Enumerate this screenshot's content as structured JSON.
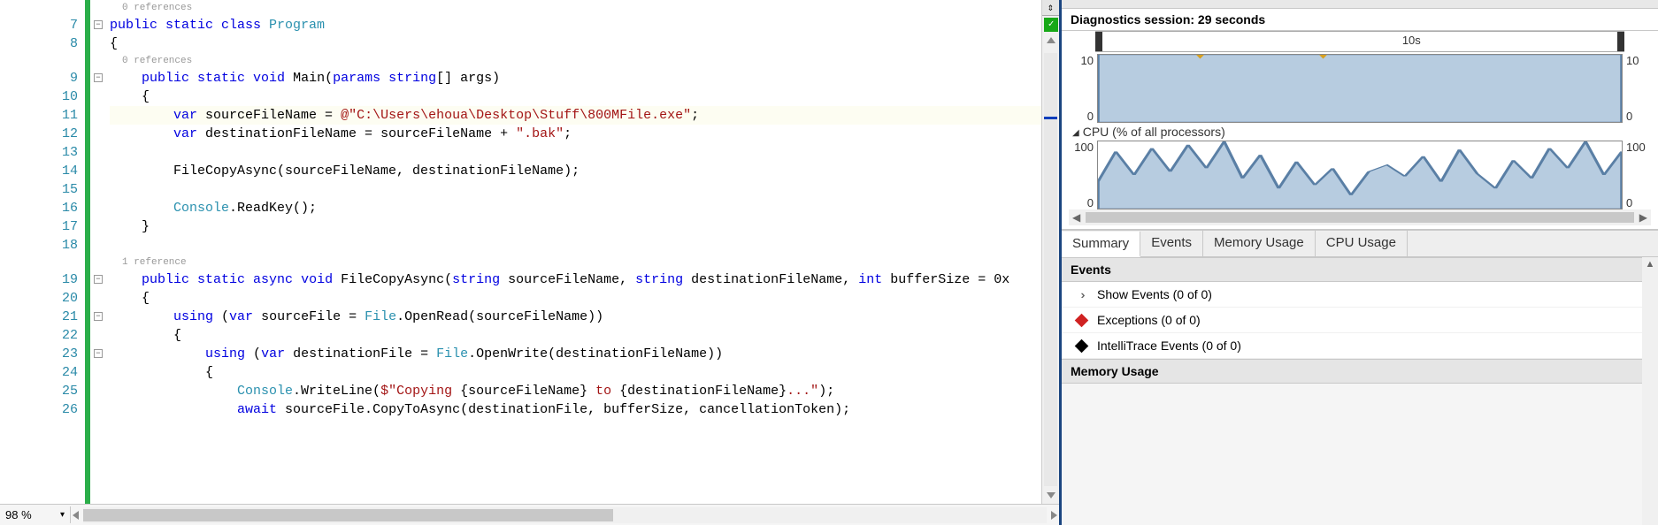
{
  "editor": {
    "zoom": "98 %",
    "refs_class": "0 references",
    "refs_main": "0 references",
    "refs_copy": "1 reference",
    "lines": {
      "7": {
        "parts": [
          {
            "t": "public ",
            "c": "kw"
          },
          {
            "t": "static ",
            "c": "kw"
          },
          {
            "t": "class ",
            "c": "kw"
          },
          {
            "t": "Program",
            "c": "type"
          }
        ]
      },
      "8": {
        "parts": [
          {
            "t": "{"
          }
        ]
      },
      "9": {
        "parts": [
          {
            "t": "    ",
            "c": ""
          },
          {
            "t": "public ",
            "c": "kw"
          },
          {
            "t": "static ",
            "c": "kw"
          },
          {
            "t": "void ",
            "c": "kw"
          },
          {
            "t": "Main(",
            "c": ""
          },
          {
            "t": "params ",
            "c": "kw"
          },
          {
            "t": "string",
            "c": "kw"
          },
          {
            "t": "[] args)",
            "c": ""
          }
        ]
      },
      "10": {
        "parts": [
          {
            "t": "    {"
          }
        ]
      },
      "11": {
        "parts": [
          {
            "t": "        ",
            "c": ""
          },
          {
            "t": "var ",
            "c": "kw"
          },
          {
            "t": "sourceFileName = ",
            "c": ""
          },
          {
            "t": "@\"C:\\Users\\ehoua\\Desktop\\Stuff\\800MFile.exe\"",
            "c": "str"
          },
          {
            "t": ";",
            "c": ""
          }
        ]
      },
      "12": {
        "parts": [
          {
            "t": "        ",
            "c": ""
          },
          {
            "t": "var ",
            "c": "kw"
          },
          {
            "t": "destinationFileName = sourceFileName + ",
            "c": ""
          },
          {
            "t": "\".bak\"",
            "c": "str"
          },
          {
            "t": ";",
            "c": ""
          }
        ]
      },
      "13": {
        "parts": [
          {
            "t": " "
          }
        ]
      },
      "14": {
        "parts": [
          {
            "t": "        FileCopyAsync(sourceFileName, destinationFileName);"
          }
        ]
      },
      "15": {
        "parts": [
          {
            "t": " "
          }
        ]
      },
      "16": {
        "parts": [
          {
            "t": "        ",
            "c": ""
          },
          {
            "t": "Console",
            "c": "type"
          },
          {
            "t": ".ReadKey();",
            "c": ""
          }
        ]
      },
      "17": {
        "parts": [
          {
            "t": "    }"
          }
        ]
      },
      "18": {
        "parts": [
          {
            "t": " "
          }
        ]
      },
      "19": {
        "parts": [
          {
            "t": "    ",
            "c": ""
          },
          {
            "t": "public ",
            "c": "kw"
          },
          {
            "t": "static ",
            "c": "kw"
          },
          {
            "t": "async ",
            "c": "kw"
          },
          {
            "t": "void ",
            "c": "kw"
          },
          {
            "t": "FileCopyAsync(",
            "c": ""
          },
          {
            "t": "string ",
            "c": "kw"
          },
          {
            "t": "sourceFileName, ",
            "c": ""
          },
          {
            "t": "string ",
            "c": "kw"
          },
          {
            "t": "destinationFileName, ",
            "c": ""
          },
          {
            "t": "int ",
            "c": "kw"
          },
          {
            "t": "bufferSize = 0x",
            "c": ""
          }
        ]
      },
      "20": {
        "parts": [
          {
            "t": "    {"
          }
        ]
      },
      "21": {
        "parts": [
          {
            "t": "        ",
            "c": ""
          },
          {
            "t": "using ",
            "c": "kw"
          },
          {
            "t": "(",
            "c": ""
          },
          {
            "t": "var ",
            "c": "kw"
          },
          {
            "t": "sourceFile = ",
            "c": ""
          },
          {
            "t": "File",
            "c": "type"
          },
          {
            "t": ".OpenRead(sourceFileName))",
            "c": ""
          }
        ]
      },
      "22": {
        "parts": [
          {
            "t": "        {"
          }
        ]
      },
      "23": {
        "parts": [
          {
            "t": "            ",
            "c": ""
          },
          {
            "t": "using ",
            "c": "kw"
          },
          {
            "t": "(",
            "c": ""
          },
          {
            "t": "var ",
            "c": "kw"
          },
          {
            "t": "destinationFile = ",
            "c": ""
          },
          {
            "t": "File",
            "c": "type"
          },
          {
            "t": ".OpenWrite(destinationFileName))",
            "c": ""
          }
        ]
      },
      "24": {
        "parts": [
          {
            "t": "            {"
          }
        ]
      },
      "25": {
        "parts": [
          {
            "t": "                ",
            "c": ""
          },
          {
            "t": "Console",
            "c": "type"
          },
          {
            "t": ".WriteLine(",
            "c": ""
          },
          {
            "t": "$\"Copying ",
            "c": "str"
          },
          {
            "t": "{sourceFileName}",
            "c": ""
          },
          {
            "t": " to ",
            "c": "str"
          },
          {
            "t": "{destinationFileName}",
            "c": ""
          },
          {
            "t": "...\"",
            "c": "str"
          },
          {
            "t": ");",
            "c": ""
          }
        ]
      },
      "26": {
        "parts": [
          {
            "t": "                ",
            "c": ""
          },
          {
            "t": "await ",
            "c": "kw"
          },
          {
            "t": "sourceFile.CopyToAsync(destinationFile, bufferSize, cancellationToken);",
            "c": ""
          }
        ]
      }
    },
    "line_numbers": [
      "7",
      "8",
      "9",
      "10",
      "11",
      "12",
      "13",
      "14",
      "15",
      "16",
      "17",
      "18",
      "19",
      "20",
      "21",
      "22",
      "23",
      "24",
      "25",
      "26"
    ],
    "fold_at": [
      "7",
      "9",
      "19",
      "21",
      "23"
    ],
    "ref_before": {
      "7": "refs_class",
      "9": "refs_main",
      "19": "refs_copy"
    },
    "highlight_line": "11"
  },
  "diagnostics": {
    "session_label": "Diagnostics session: 29 seconds",
    "timeline": {
      "tick_label": "10s"
    },
    "memory_chart": {
      "y_hi": "10",
      "y_lo": "0"
    },
    "cpu_chart": {
      "title": "CPU (% of all processors)",
      "y_hi": "100",
      "y_lo": "0"
    },
    "tabs": [
      "Summary",
      "Events",
      "Memory Usage",
      "CPU Usage"
    ],
    "active_tab": 0,
    "events_header": "Events",
    "events": [
      {
        "icon": "chevrons",
        "label": "Show Events (0 of 0)"
      },
      {
        "icon": "red-diamond",
        "label": "Exceptions (0 of 0)"
      },
      {
        "icon": "black-diamond",
        "label": "IntelliTrace Events (0 of 0)"
      }
    ],
    "memory_header": "Memory Usage"
  },
  "chart_data": [
    {
      "type": "area",
      "title": "Process Memory",
      "x_seconds": [
        0,
        29
      ],
      "values": [
        10,
        10
      ],
      "ylim": [
        0,
        10
      ],
      "ylabel": "",
      "gc_markers_sec": [
        5.5,
        12.3
      ]
    },
    {
      "type": "area",
      "title": "CPU (% of all processors)",
      "x_seconds": [
        0,
        1,
        2,
        3,
        4,
        5,
        6,
        7,
        8,
        9,
        10,
        11,
        12,
        13,
        14,
        15,
        16,
        17,
        18,
        19,
        20,
        21,
        22,
        23,
        24,
        25,
        26,
        27,
        28,
        29
      ],
      "values": [
        40,
        85,
        50,
        90,
        55,
        95,
        60,
        100,
        45,
        80,
        30,
        70,
        35,
        60,
        20,
        55,
        65,
        48,
        78,
        40,
        88,
        52,
        30,
        72,
        45,
        90,
        60,
        100,
        50,
        85
      ],
      "ylim": [
        0,
        100
      ],
      "ylabel": "%"
    }
  ]
}
